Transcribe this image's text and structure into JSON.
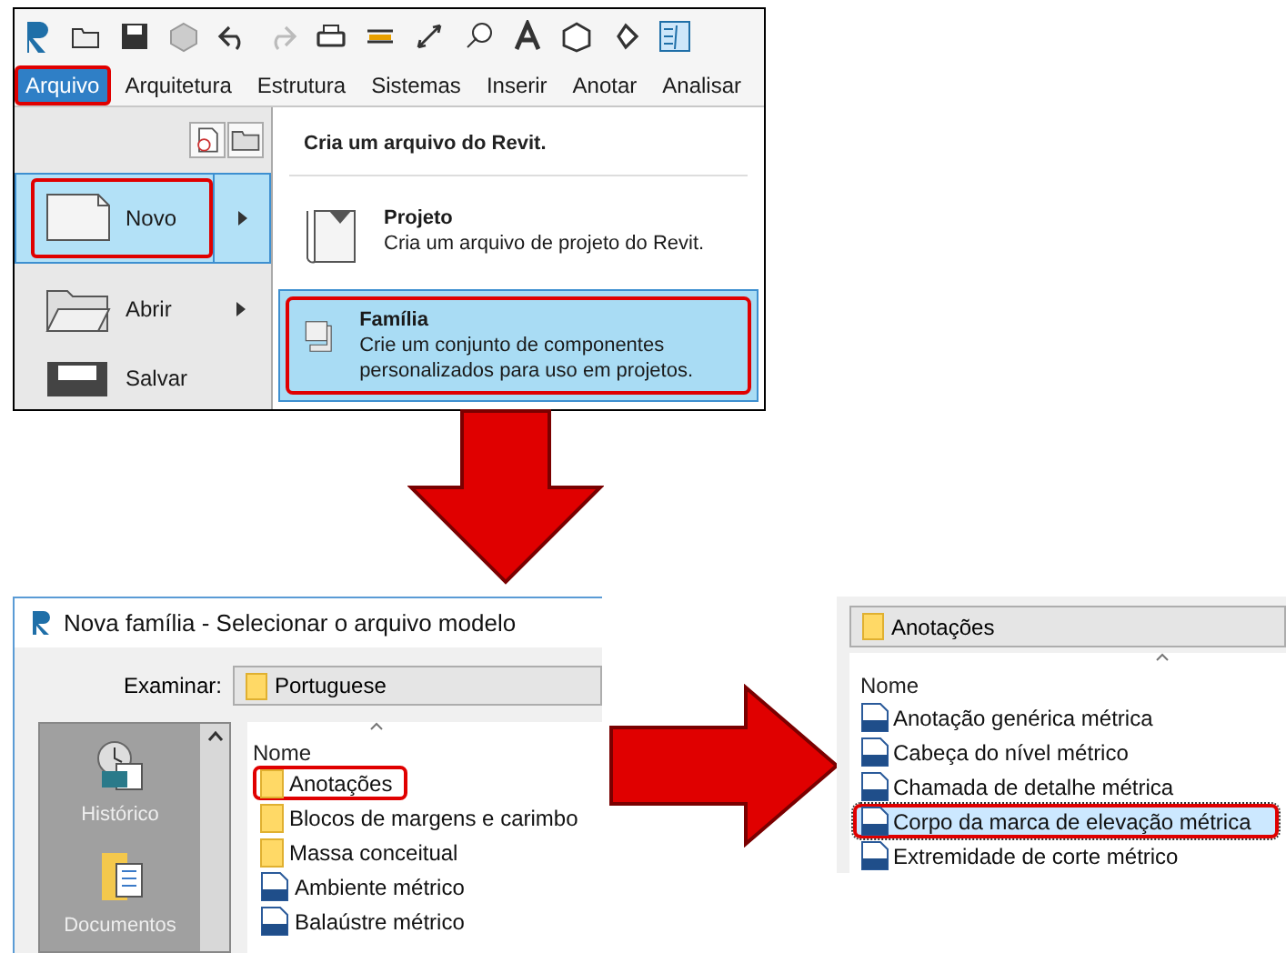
{
  "revit_menu": {
    "tabs": [
      {
        "label": "Arquivo",
        "selected": true,
        "highlighted": true
      },
      {
        "label": "Arquitetura",
        "selected": false,
        "highlighted": false
      },
      {
        "label": "Estrutura",
        "selected": false,
        "highlighted": false
      },
      {
        "label": "Sistemas",
        "selected": false,
        "highlighted": false
      },
      {
        "label": "Inserir",
        "selected": false,
        "highlighted": false
      },
      {
        "label": "Anotar",
        "selected": false,
        "highlighted": false
      },
      {
        "label": "Analisar",
        "selected": false,
        "highlighted": false
      }
    ],
    "menu_items": [
      {
        "kind": "new",
        "label": "Novo",
        "selected": true,
        "highlighted": true,
        "has_submenu": true
      },
      {
        "kind": "open",
        "label": "Abrir",
        "selected": false,
        "highlighted": false,
        "has_submenu": true
      },
      {
        "kind": "save",
        "label": "Salvar",
        "selected": false,
        "highlighted": false,
        "has_submenu": false
      }
    ],
    "submenu": {
      "heading": "Cria um arquivo do Revit.",
      "items": [
        {
          "kind": "project",
          "title": "Projeto",
          "description": "Cria um arquivo de projeto do Revit.",
          "selected": false,
          "highlighted": false
        },
        {
          "kind": "family",
          "title": "Família",
          "description": "Crie um conjunto de componentes personalizados para uso em projetos.",
          "selected": true,
          "highlighted": true
        }
      ]
    }
  },
  "template_dialog": {
    "title": "Nova família - Selecionar o arquivo modelo",
    "look_in_label": "Examinar:",
    "look_in_value": "Portuguese",
    "places": [
      {
        "kind": "history",
        "label": "Histórico"
      },
      {
        "kind": "documents",
        "label": "Documentos"
      }
    ],
    "column": "Nome",
    "files": [
      {
        "kind": "folder",
        "name": "Anotações",
        "highlighted": true
      },
      {
        "kind": "folder",
        "name": "Blocos de margens e carimbo",
        "highlighted": false
      },
      {
        "kind": "folder",
        "name": "Massa conceitual",
        "highlighted": false
      },
      {
        "kind": "rft",
        "name": "Ambiente métrico",
        "highlighted": false
      },
      {
        "kind": "rft",
        "name": "Balaústre métrico",
        "highlighted": false
      }
    ]
  },
  "annotations_folder": {
    "path": "Anotações",
    "column": "Nome",
    "files": [
      {
        "kind": "rft",
        "name": "Anotação genérica métrica",
        "selected": false,
        "highlighted": false
      },
      {
        "kind": "rft",
        "name": "Cabeça do nível métrico",
        "selected": false,
        "highlighted": false
      },
      {
        "kind": "rft",
        "name": "Chamada de detalhe métrica",
        "selected": false,
        "highlighted": false
      },
      {
        "kind": "rft",
        "name": "Corpo da marca de elevação métrica",
        "selected": true,
        "highlighted": true
      },
      {
        "kind": "rft",
        "name": "Extremidade de corte métrico",
        "selected": false,
        "highlighted": false
      }
    ]
  }
}
